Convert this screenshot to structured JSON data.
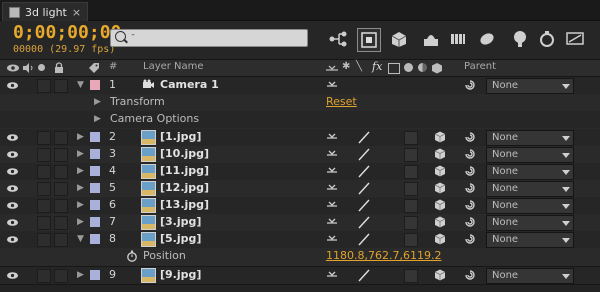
{
  "tab": {
    "title": "3d light",
    "close_label": "×"
  },
  "toolbar": {
    "timecode": "0;00;00;00",
    "frame_info": "00000 (29.97 fps)",
    "search_placeholder": "ᐨ"
  },
  "columns": {
    "hash": "#",
    "layer_name": "Layer Name",
    "switches_fx": "fx",
    "parent": "Parent"
  },
  "rows": [
    {
      "num": "1",
      "name": "Camera 1",
      "type": "camera",
      "label_color": "#e8a8b8",
      "expanded": true,
      "parent": "None"
    },
    {
      "prop": "Transform",
      "value": "Reset"
    },
    {
      "prop": "Camera Options"
    },
    {
      "num": "2",
      "name": "[1.jpg]",
      "label_color": "#a9b0d9",
      "parent": "None"
    },
    {
      "num": "3",
      "name": "[10.jpg]",
      "label_color": "#a9b0d9",
      "parent": "None"
    },
    {
      "num": "4",
      "name": "[11.jpg]",
      "label_color": "#a9b0d9",
      "parent": "None"
    },
    {
      "num": "5",
      "name": "[12.jpg]",
      "label_color": "#a9b0d9",
      "parent": "None"
    },
    {
      "num": "6",
      "name": "[13.jpg]",
      "label_color": "#a9b0d9",
      "parent": "None"
    },
    {
      "num": "7",
      "name": "[3.jpg]",
      "label_color": "#a9b0d9",
      "parent": "None"
    },
    {
      "num": "8",
      "name": "[5.jpg]",
      "label_color": "#a9b0d9",
      "expanded": true,
      "parent": "None"
    },
    {
      "prop": "Position",
      "value": "1180.8,762.7,6119.2"
    },
    {
      "num": "9",
      "name": "[9.jpg]",
      "label_color": "#a9b0d9",
      "parent": "None"
    }
  ],
  "colors": {
    "accent": "#e7a92b",
    "panel": "#262626"
  }
}
